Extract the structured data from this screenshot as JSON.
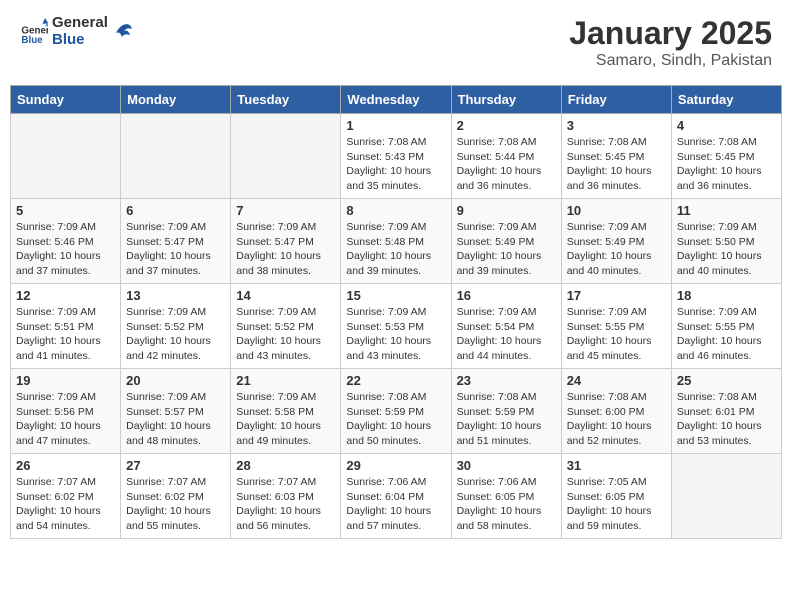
{
  "header": {
    "logo_text_general": "General",
    "logo_text_blue": "Blue",
    "title": "January 2025",
    "subtitle": "Samaro, Sindh, Pakistan"
  },
  "days_of_week": [
    "Sunday",
    "Monday",
    "Tuesday",
    "Wednesday",
    "Thursday",
    "Friday",
    "Saturday"
  ],
  "weeks": [
    [
      {
        "day": "",
        "info": ""
      },
      {
        "day": "",
        "info": ""
      },
      {
        "day": "",
        "info": ""
      },
      {
        "day": "1",
        "info": "Sunrise: 7:08 AM\nSunset: 5:43 PM\nDaylight: 10 hours\nand 35 minutes."
      },
      {
        "day": "2",
        "info": "Sunrise: 7:08 AM\nSunset: 5:44 PM\nDaylight: 10 hours\nand 36 minutes."
      },
      {
        "day": "3",
        "info": "Sunrise: 7:08 AM\nSunset: 5:45 PM\nDaylight: 10 hours\nand 36 minutes."
      },
      {
        "day": "4",
        "info": "Sunrise: 7:08 AM\nSunset: 5:45 PM\nDaylight: 10 hours\nand 36 minutes."
      }
    ],
    [
      {
        "day": "5",
        "info": "Sunrise: 7:09 AM\nSunset: 5:46 PM\nDaylight: 10 hours\nand 37 minutes."
      },
      {
        "day": "6",
        "info": "Sunrise: 7:09 AM\nSunset: 5:47 PM\nDaylight: 10 hours\nand 37 minutes."
      },
      {
        "day": "7",
        "info": "Sunrise: 7:09 AM\nSunset: 5:47 PM\nDaylight: 10 hours\nand 38 minutes."
      },
      {
        "day": "8",
        "info": "Sunrise: 7:09 AM\nSunset: 5:48 PM\nDaylight: 10 hours\nand 39 minutes."
      },
      {
        "day": "9",
        "info": "Sunrise: 7:09 AM\nSunset: 5:49 PM\nDaylight: 10 hours\nand 39 minutes."
      },
      {
        "day": "10",
        "info": "Sunrise: 7:09 AM\nSunset: 5:49 PM\nDaylight: 10 hours\nand 40 minutes."
      },
      {
        "day": "11",
        "info": "Sunrise: 7:09 AM\nSunset: 5:50 PM\nDaylight: 10 hours\nand 40 minutes."
      }
    ],
    [
      {
        "day": "12",
        "info": "Sunrise: 7:09 AM\nSunset: 5:51 PM\nDaylight: 10 hours\nand 41 minutes."
      },
      {
        "day": "13",
        "info": "Sunrise: 7:09 AM\nSunset: 5:52 PM\nDaylight: 10 hours\nand 42 minutes."
      },
      {
        "day": "14",
        "info": "Sunrise: 7:09 AM\nSunset: 5:52 PM\nDaylight: 10 hours\nand 43 minutes."
      },
      {
        "day": "15",
        "info": "Sunrise: 7:09 AM\nSunset: 5:53 PM\nDaylight: 10 hours\nand 43 minutes."
      },
      {
        "day": "16",
        "info": "Sunrise: 7:09 AM\nSunset: 5:54 PM\nDaylight: 10 hours\nand 44 minutes."
      },
      {
        "day": "17",
        "info": "Sunrise: 7:09 AM\nSunset: 5:55 PM\nDaylight: 10 hours\nand 45 minutes."
      },
      {
        "day": "18",
        "info": "Sunrise: 7:09 AM\nSunset: 5:55 PM\nDaylight: 10 hours\nand 46 minutes."
      }
    ],
    [
      {
        "day": "19",
        "info": "Sunrise: 7:09 AM\nSunset: 5:56 PM\nDaylight: 10 hours\nand 47 minutes."
      },
      {
        "day": "20",
        "info": "Sunrise: 7:09 AM\nSunset: 5:57 PM\nDaylight: 10 hours\nand 48 minutes."
      },
      {
        "day": "21",
        "info": "Sunrise: 7:09 AM\nSunset: 5:58 PM\nDaylight: 10 hours\nand 49 minutes."
      },
      {
        "day": "22",
        "info": "Sunrise: 7:08 AM\nSunset: 5:59 PM\nDaylight: 10 hours\nand 50 minutes."
      },
      {
        "day": "23",
        "info": "Sunrise: 7:08 AM\nSunset: 5:59 PM\nDaylight: 10 hours\nand 51 minutes."
      },
      {
        "day": "24",
        "info": "Sunrise: 7:08 AM\nSunset: 6:00 PM\nDaylight: 10 hours\nand 52 minutes."
      },
      {
        "day": "25",
        "info": "Sunrise: 7:08 AM\nSunset: 6:01 PM\nDaylight: 10 hours\nand 53 minutes."
      }
    ],
    [
      {
        "day": "26",
        "info": "Sunrise: 7:07 AM\nSunset: 6:02 PM\nDaylight: 10 hours\nand 54 minutes."
      },
      {
        "day": "27",
        "info": "Sunrise: 7:07 AM\nSunset: 6:02 PM\nDaylight: 10 hours\nand 55 minutes."
      },
      {
        "day": "28",
        "info": "Sunrise: 7:07 AM\nSunset: 6:03 PM\nDaylight: 10 hours\nand 56 minutes."
      },
      {
        "day": "29",
        "info": "Sunrise: 7:06 AM\nSunset: 6:04 PM\nDaylight: 10 hours\nand 57 minutes."
      },
      {
        "day": "30",
        "info": "Sunrise: 7:06 AM\nSunset: 6:05 PM\nDaylight: 10 hours\nand 58 minutes."
      },
      {
        "day": "31",
        "info": "Sunrise: 7:05 AM\nSunset: 6:05 PM\nDaylight: 10 hours\nand 59 minutes."
      },
      {
        "day": "",
        "info": ""
      }
    ]
  ]
}
